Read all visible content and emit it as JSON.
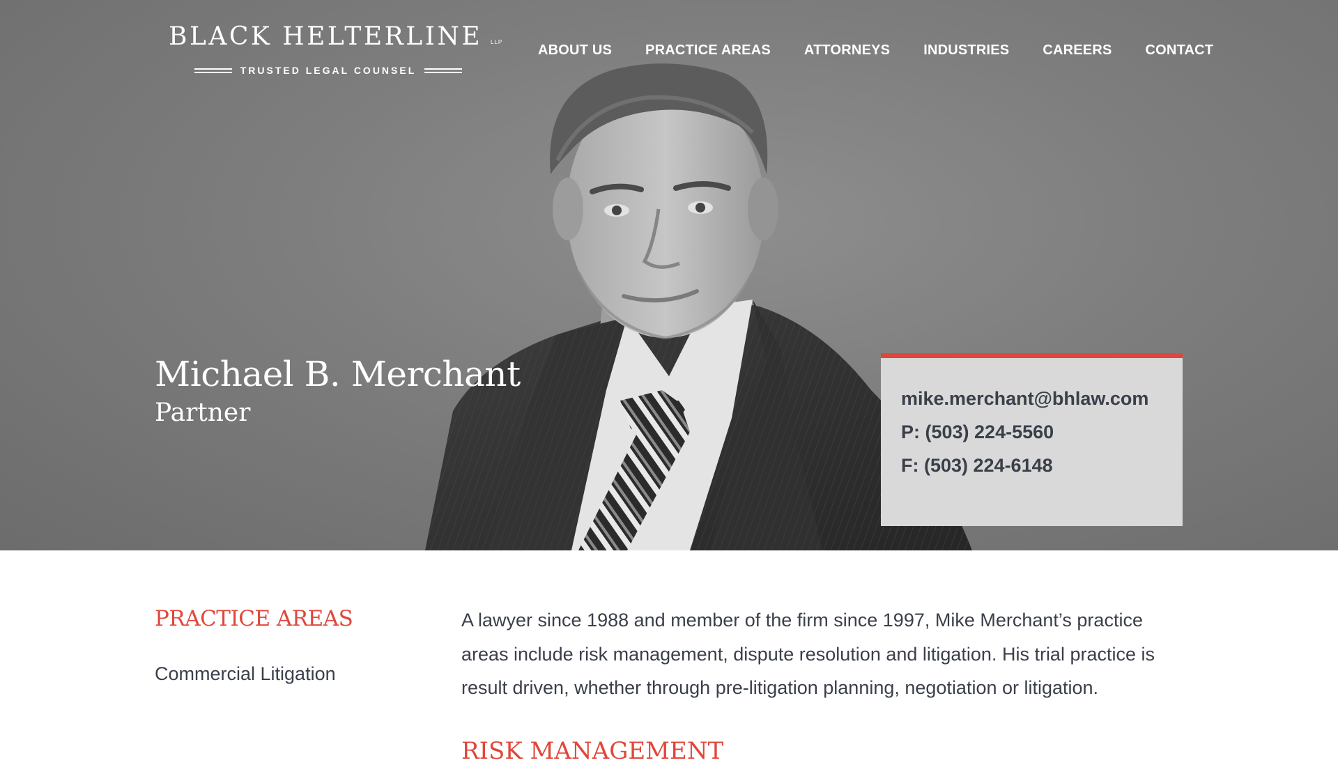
{
  "logo": {
    "name": "BLACK HELTERLINE",
    "suffix": "LLP",
    "tagline": "TRUSTED LEGAL COUNSEL"
  },
  "nav": {
    "items": [
      {
        "label": "ABOUT US"
      },
      {
        "label": "PRACTICE AREAS"
      },
      {
        "label": "ATTORNEYS"
      },
      {
        "label": "INDUSTRIES"
      },
      {
        "label": "CAREERS"
      },
      {
        "label": "CONTACT"
      }
    ]
  },
  "attorney": {
    "name": "Michael B. Merchant",
    "title": "Partner"
  },
  "contact": {
    "email": "mike.merchant@bhlaw.com",
    "phone": "P: (503) 224-5560",
    "fax": "F: (503) 224-6148"
  },
  "practice_areas": {
    "heading": "PRACTICE AREAS",
    "items": [
      "Commercial Litigation"
    ]
  },
  "bio": {
    "text": "A lawyer since 1988 and member of the firm since 1997, Mike Merchant’s practice areas include risk management, dispute resolution and litigation. His trial practice is result driven, whether through pre-litigation planning, negotiation or litigation."
  },
  "section": {
    "heading": "RISK MANAGEMENT"
  },
  "colors": {
    "accent": "#e0473a",
    "text": "#3a3f4a",
    "card": "#d9d9d9"
  }
}
